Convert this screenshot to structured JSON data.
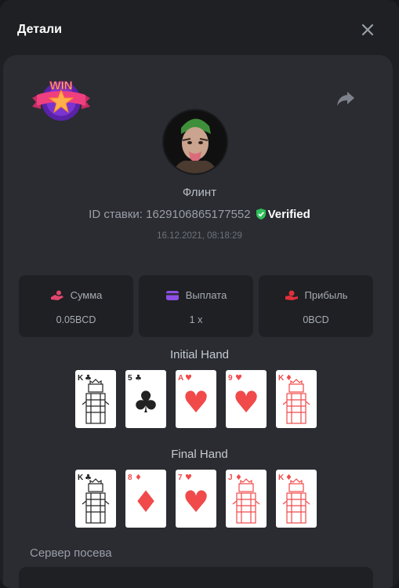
{
  "dialog": {
    "title": "Детали"
  },
  "icons": {
    "close": "close-icon",
    "share": "share-icon",
    "win_badge": "win-badge-icon",
    "verified": "shield-check-icon"
  },
  "badge": {
    "text": "WIN"
  },
  "player": {
    "name": "Флинт"
  },
  "bet": {
    "id_text": "ID ставки: 1629106865177552",
    "verified_label": "Verified",
    "datetime": "16.12.2021, 08:18:29"
  },
  "stats": {
    "amount": {
      "label": "Сумма",
      "value": "0.05BCD",
      "icon": "coins-hand-icon",
      "color": "#e0466e"
    },
    "payout": {
      "label": "Выплата",
      "value": "1 x",
      "icon": "wallet-icon",
      "color": "#8d4fe6"
    },
    "profit": {
      "label": "Прибыль",
      "value": "0BCD",
      "icon": "profit-hand-icon",
      "color": "#e0303a"
    }
  },
  "initial_hand": {
    "title": "Initial Hand",
    "cards": [
      {
        "rank": "K",
        "suit": "♣",
        "color": "#222222"
      },
      {
        "rank": "5",
        "suit": "♣",
        "color": "#222222"
      },
      {
        "rank": "A",
        "suit": "♥",
        "color": "#f04a4a"
      },
      {
        "rank": "9",
        "suit": "♥",
        "color": "#f04a4a"
      },
      {
        "rank": "K",
        "suit": "♦",
        "color": "#f04a4a"
      }
    ]
  },
  "final_hand": {
    "title": "Final Hand",
    "cards": [
      {
        "rank": "K",
        "suit": "♣",
        "color": "#222222"
      },
      {
        "rank": "8",
        "suit": "♦",
        "color": "#f04a4a"
      },
      {
        "rank": "7",
        "suit": "♥",
        "color": "#f04a4a"
      },
      {
        "rank": "J",
        "suit": "♦",
        "color": "#f04a4a"
      },
      {
        "rank": "K",
        "suit": "♦",
        "color": "#f04a4a"
      }
    ]
  },
  "seed": {
    "title": "Сервер посева"
  }
}
